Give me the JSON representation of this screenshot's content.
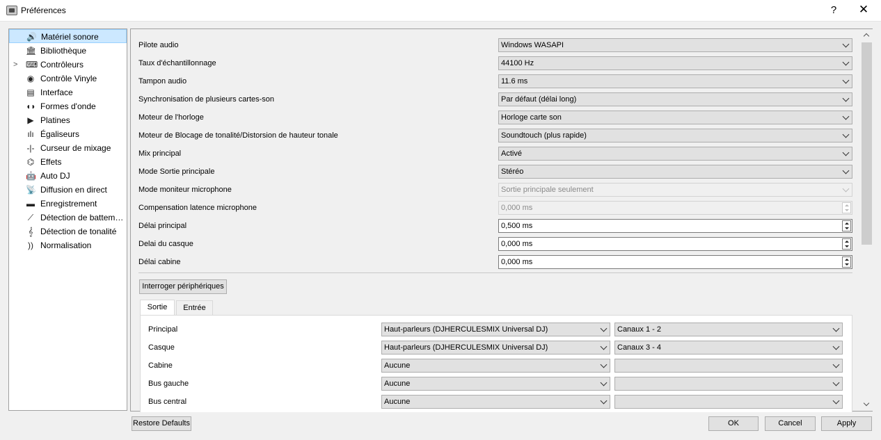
{
  "window": {
    "title": "Préférences",
    "help": "?",
    "close": "✕"
  },
  "sidebar": {
    "items": [
      {
        "label": "Matériel sonore",
        "icon": "🔊"
      },
      {
        "label": "Bibliothèque",
        "icon": "🏛"
      },
      {
        "label": "Contrôleurs",
        "icon": "⌨"
      },
      {
        "label": "Contrôle Vinyle",
        "icon": "◉"
      },
      {
        "label": "Interface",
        "icon": "▤"
      },
      {
        "label": "Formes d'onde",
        "icon": "◖◗"
      },
      {
        "label": "Platines",
        "icon": "▶"
      },
      {
        "label": "Égaliseurs",
        "icon": "ılı"
      },
      {
        "label": "Curseur de mixage",
        "icon": "‑|‑"
      },
      {
        "label": "Effets",
        "icon": "⌬"
      },
      {
        "label": "Auto DJ",
        "icon": "🤖"
      },
      {
        "label": "Diffusion en direct",
        "icon": "📡"
      },
      {
        "label": "Enregistrement",
        "icon": "▬"
      },
      {
        "label": "Détection de battem…",
        "icon": "⟋"
      },
      {
        "label": "Détection de tonalité",
        "icon": "𝄞"
      },
      {
        "label": "Normalisation",
        "icon": "))"
      }
    ],
    "expander": ">"
  },
  "settings": {
    "rows": [
      {
        "label": "Pilote audio",
        "value": "Windows WASAPI"
      },
      {
        "label": "Taux d'échantillonnage",
        "value": "44100 Hz"
      },
      {
        "label": "Tampon audio",
        "value": "11.6 ms"
      },
      {
        "label": "Synchronisation de plusieurs cartes-son",
        "value": "Par défaut (délai long)"
      },
      {
        "label": "Moteur de l'horloge",
        "value": "Horloge carte son"
      },
      {
        "label": "Moteur de Blocage de tonalité/Distorsion de hauteur tonale",
        "value": "Soundtouch (plus rapide)"
      },
      {
        "label": "Mix principal",
        "value": "Activé"
      },
      {
        "label": "Mode Sortie principale",
        "value": "Stéréo"
      },
      {
        "label": "Mode moniteur microphone",
        "value": "Sortie principale seulement"
      },
      {
        "label": "Compensation latence microphone",
        "value": "0,000 ms"
      },
      {
        "label": "Délai principal",
        "value": "0,500 ms"
      },
      {
        "label": "Delai du casque",
        "value": "0,000 ms"
      },
      {
        "label": "Délai cabine",
        "value": "0,000 ms"
      }
    ]
  },
  "query_button": "Interroger périphériques",
  "tabs": [
    {
      "label": "Sortie"
    },
    {
      "label": "Entrée"
    }
  ],
  "outputs": {
    "rows": [
      {
        "label": "Principal",
        "device": "Haut-parleurs (DJHERCULESMIX Universal DJ)",
        "channels": "Canaux 1 - 2"
      },
      {
        "label": "Casque",
        "device": "Haut-parleurs (DJHERCULESMIX Universal DJ)",
        "channels": "Canaux 3 - 4"
      },
      {
        "label": "Cabine",
        "device": "Aucune",
        "channels": ""
      },
      {
        "label": "Bus gauche",
        "device": "Aucune",
        "channels": ""
      },
      {
        "label": "Bus central",
        "device": "Aucune",
        "channels": ""
      }
    ]
  },
  "footer": {
    "restore": "Restore Defaults",
    "ok": "OK",
    "cancel": "Cancel",
    "apply": "Apply"
  }
}
